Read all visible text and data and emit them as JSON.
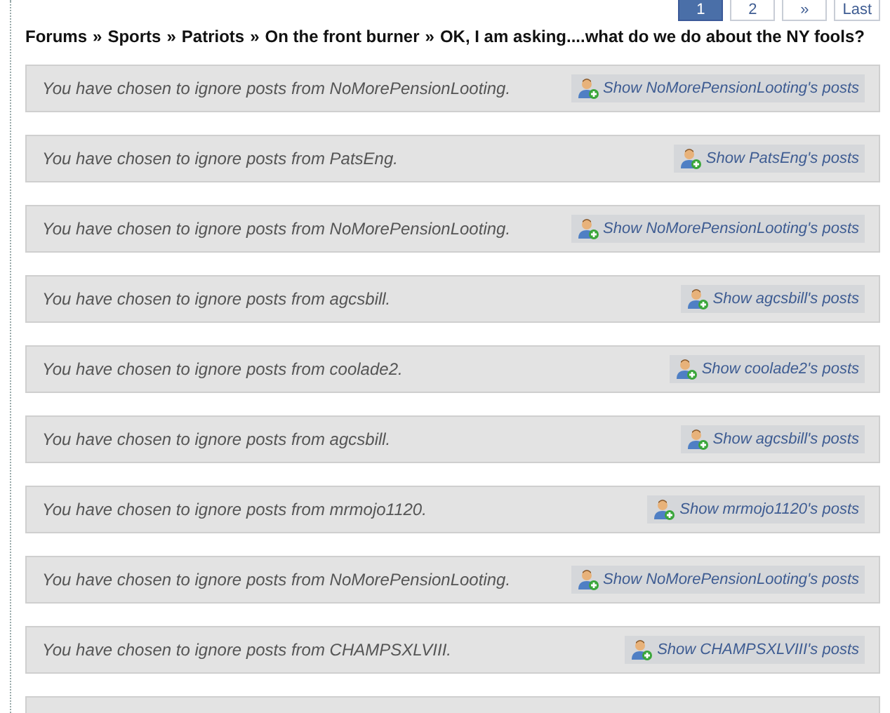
{
  "pagination": [
    {
      "label": "1",
      "selected": true
    },
    {
      "label": "2",
      "selected": false
    },
    {
      "label": "»",
      "selected": false
    },
    {
      "label": "Last",
      "selected": false
    }
  ],
  "breadcrumb": [
    "Forums",
    "Sports",
    "Patriots",
    "On the front burner",
    "OK, I am asking....what do we do about the NY fools?"
  ],
  "breadcrumb_separator": "»",
  "ignored_posts": [
    {
      "message": "You have chosen to ignore posts from NoMorePensionLooting.",
      "button": "Show NoMorePensionLooting's posts"
    },
    {
      "message": "You have chosen to ignore posts from PatsEng.",
      "button": "Show PatsEng's posts"
    },
    {
      "message": "You have chosen to ignore posts from NoMorePensionLooting.",
      "button": "Show NoMorePensionLooting's posts"
    },
    {
      "message": "You have chosen to ignore posts from agcsbill.",
      "button": "Show agcsbill's posts"
    },
    {
      "message": "You have chosen to ignore posts from coolade2.",
      "button": "Show coolade2's posts"
    },
    {
      "message": "You have chosen to ignore posts from agcsbill.",
      "button": "Show agcsbill's posts"
    },
    {
      "message": "You have chosen to ignore posts from mrmojo1120.",
      "button": "Show mrmojo1120's posts"
    },
    {
      "message": "You have chosen to ignore posts from NoMorePensionLooting.",
      "button": "Show NoMorePensionLooting's posts"
    },
    {
      "message": "You have chosen to ignore posts from CHAMPSXLVIII.",
      "button": "Show CHAMPSXLVIII's posts"
    }
  ]
}
